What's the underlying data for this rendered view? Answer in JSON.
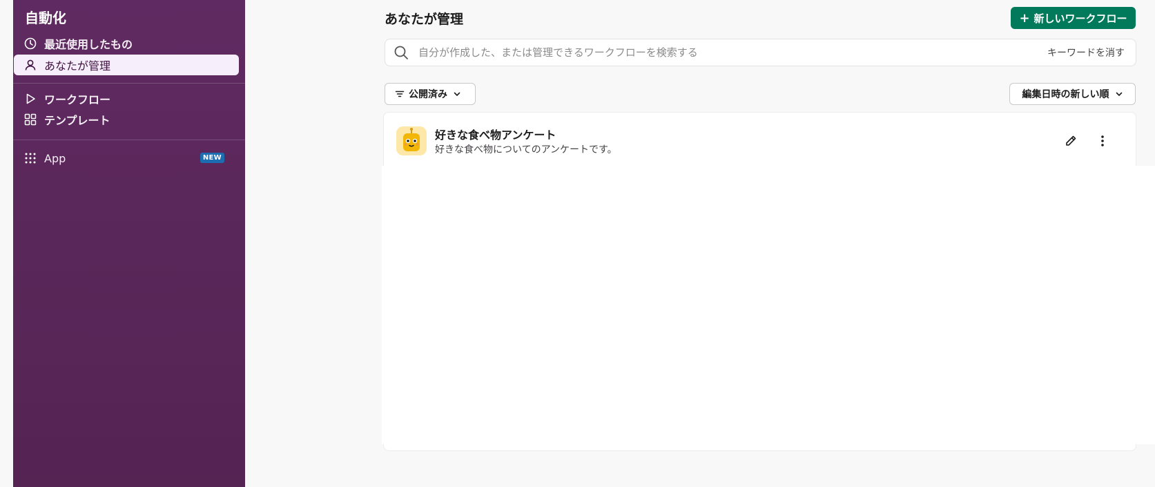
{
  "sidebar": {
    "title": "自動化",
    "items": [
      {
        "label": "最近使用したもの",
        "icon": "clock-icon"
      },
      {
        "label": "あなたが管理",
        "icon": "person-icon",
        "active": true
      },
      {
        "label": "ワークフロー",
        "icon": "play-icon"
      },
      {
        "label": "テンプレート",
        "icon": "grid-icon"
      },
      {
        "label": "App",
        "icon": "dots-grid-icon",
        "badge": "NEW"
      }
    ]
  },
  "main": {
    "title": "あなたが管理",
    "new_workflow_label": "新しいワークフロー",
    "search": {
      "placeholder": "自分が作成した、または管理できるワークフローを検索する",
      "value": "",
      "clear_label": "キーワードを消す"
    },
    "filter_label": "公開済み",
    "sort_label": "編集日時の新しい順",
    "workflows": [
      {
        "name": "好きな食べ物アンケート",
        "description": "好きな食べ物についてのアンケートです。"
      }
    ]
  },
  "colors": {
    "sidebar_bg": "#5f2a61",
    "accent_green": "#007a5a",
    "badge_blue": "#1d6db3",
    "active_item_bg": "#f6eefb"
  }
}
